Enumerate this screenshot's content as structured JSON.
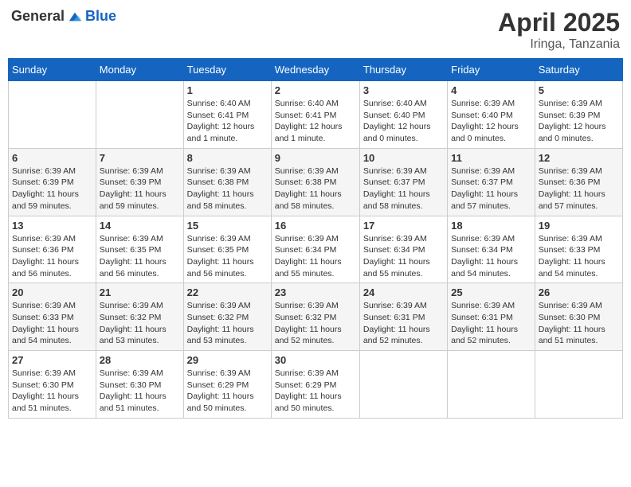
{
  "header": {
    "logo_general": "General",
    "logo_blue": "Blue",
    "title": "April 2025",
    "subtitle": "Iringa, Tanzania"
  },
  "days_of_week": [
    "Sunday",
    "Monday",
    "Tuesday",
    "Wednesday",
    "Thursday",
    "Friday",
    "Saturday"
  ],
  "weeks": [
    [
      {
        "day": "",
        "info": ""
      },
      {
        "day": "",
        "info": ""
      },
      {
        "day": "1",
        "info": "Sunrise: 6:40 AM\nSunset: 6:41 PM\nDaylight: 12 hours and 1 minute."
      },
      {
        "day": "2",
        "info": "Sunrise: 6:40 AM\nSunset: 6:41 PM\nDaylight: 12 hours and 1 minute."
      },
      {
        "day": "3",
        "info": "Sunrise: 6:40 AM\nSunset: 6:40 PM\nDaylight: 12 hours and 0 minutes."
      },
      {
        "day": "4",
        "info": "Sunrise: 6:39 AM\nSunset: 6:40 PM\nDaylight: 12 hours and 0 minutes."
      },
      {
        "day": "5",
        "info": "Sunrise: 6:39 AM\nSunset: 6:39 PM\nDaylight: 12 hours and 0 minutes."
      }
    ],
    [
      {
        "day": "6",
        "info": "Sunrise: 6:39 AM\nSunset: 6:39 PM\nDaylight: 11 hours and 59 minutes."
      },
      {
        "day": "7",
        "info": "Sunrise: 6:39 AM\nSunset: 6:39 PM\nDaylight: 11 hours and 59 minutes."
      },
      {
        "day": "8",
        "info": "Sunrise: 6:39 AM\nSunset: 6:38 PM\nDaylight: 11 hours and 58 minutes."
      },
      {
        "day": "9",
        "info": "Sunrise: 6:39 AM\nSunset: 6:38 PM\nDaylight: 11 hours and 58 minutes."
      },
      {
        "day": "10",
        "info": "Sunrise: 6:39 AM\nSunset: 6:37 PM\nDaylight: 11 hours and 58 minutes."
      },
      {
        "day": "11",
        "info": "Sunrise: 6:39 AM\nSunset: 6:37 PM\nDaylight: 11 hours and 57 minutes."
      },
      {
        "day": "12",
        "info": "Sunrise: 6:39 AM\nSunset: 6:36 PM\nDaylight: 11 hours and 57 minutes."
      }
    ],
    [
      {
        "day": "13",
        "info": "Sunrise: 6:39 AM\nSunset: 6:36 PM\nDaylight: 11 hours and 56 minutes."
      },
      {
        "day": "14",
        "info": "Sunrise: 6:39 AM\nSunset: 6:35 PM\nDaylight: 11 hours and 56 minutes."
      },
      {
        "day": "15",
        "info": "Sunrise: 6:39 AM\nSunset: 6:35 PM\nDaylight: 11 hours and 56 minutes."
      },
      {
        "day": "16",
        "info": "Sunrise: 6:39 AM\nSunset: 6:34 PM\nDaylight: 11 hours and 55 minutes."
      },
      {
        "day": "17",
        "info": "Sunrise: 6:39 AM\nSunset: 6:34 PM\nDaylight: 11 hours and 55 minutes."
      },
      {
        "day": "18",
        "info": "Sunrise: 6:39 AM\nSunset: 6:34 PM\nDaylight: 11 hours and 54 minutes."
      },
      {
        "day": "19",
        "info": "Sunrise: 6:39 AM\nSunset: 6:33 PM\nDaylight: 11 hours and 54 minutes."
      }
    ],
    [
      {
        "day": "20",
        "info": "Sunrise: 6:39 AM\nSunset: 6:33 PM\nDaylight: 11 hours and 54 minutes."
      },
      {
        "day": "21",
        "info": "Sunrise: 6:39 AM\nSunset: 6:32 PM\nDaylight: 11 hours and 53 minutes."
      },
      {
        "day": "22",
        "info": "Sunrise: 6:39 AM\nSunset: 6:32 PM\nDaylight: 11 hours and 53 minutes."
      },
      {
        "day": "23",
        "info": "Sunrise: 6:39 AM\nSunset: 6:32 PM\nDaylight: 11 hours and 52 minutes."
      },
      {
        "day": "24",
        "info": "Sunrise: 6:39 AM\nSunset: 6:31 PM\nDaylight: 11 hours and 52 minutes."
      },
      {
        "day": "25",
        "info": "Sunrise: 6:39 AM\nSunset: 6:31 PM\nDaylight: 11 hours and 52 minutes."
      },
      {
        "day": "26",
        "info": "Sunrise: 6:39 AM\nSunset: 6:30 PM\nDaylight: 11 hours and 51 minutes."
      }
    ],
    [
      {
        "day": "27",
        "info": "Sunrise: 6:39 AM\nSunset: 6:30 PM\nDaylight: 11 hours and 51 minutes."
      },
      {
        "day": "28",
        "info": "Sunrise: 6:39 AM\nSunset: 6:30 PM\nDaylight: 11 hours and 51 minutes."
      },
      {
        "day": "29",
        "info": "Sunrise: 6:39 AM\nSunset: 6:29 PM\nDaylight: 11 hours and 50 minutes."
      },
      {
        "day": "30",
        "info": "Sunrise: 6:39 AM\nSunset: 6:29 PM\nDaylight: 11 hours and 50 minutes."
      },
      {
        "day": "",
        "info": ""
      },
      {
        "day": "",
        "info": ""
      },
      {
        "day": "",
        "info": ""
      }
    ]
  ]
}
